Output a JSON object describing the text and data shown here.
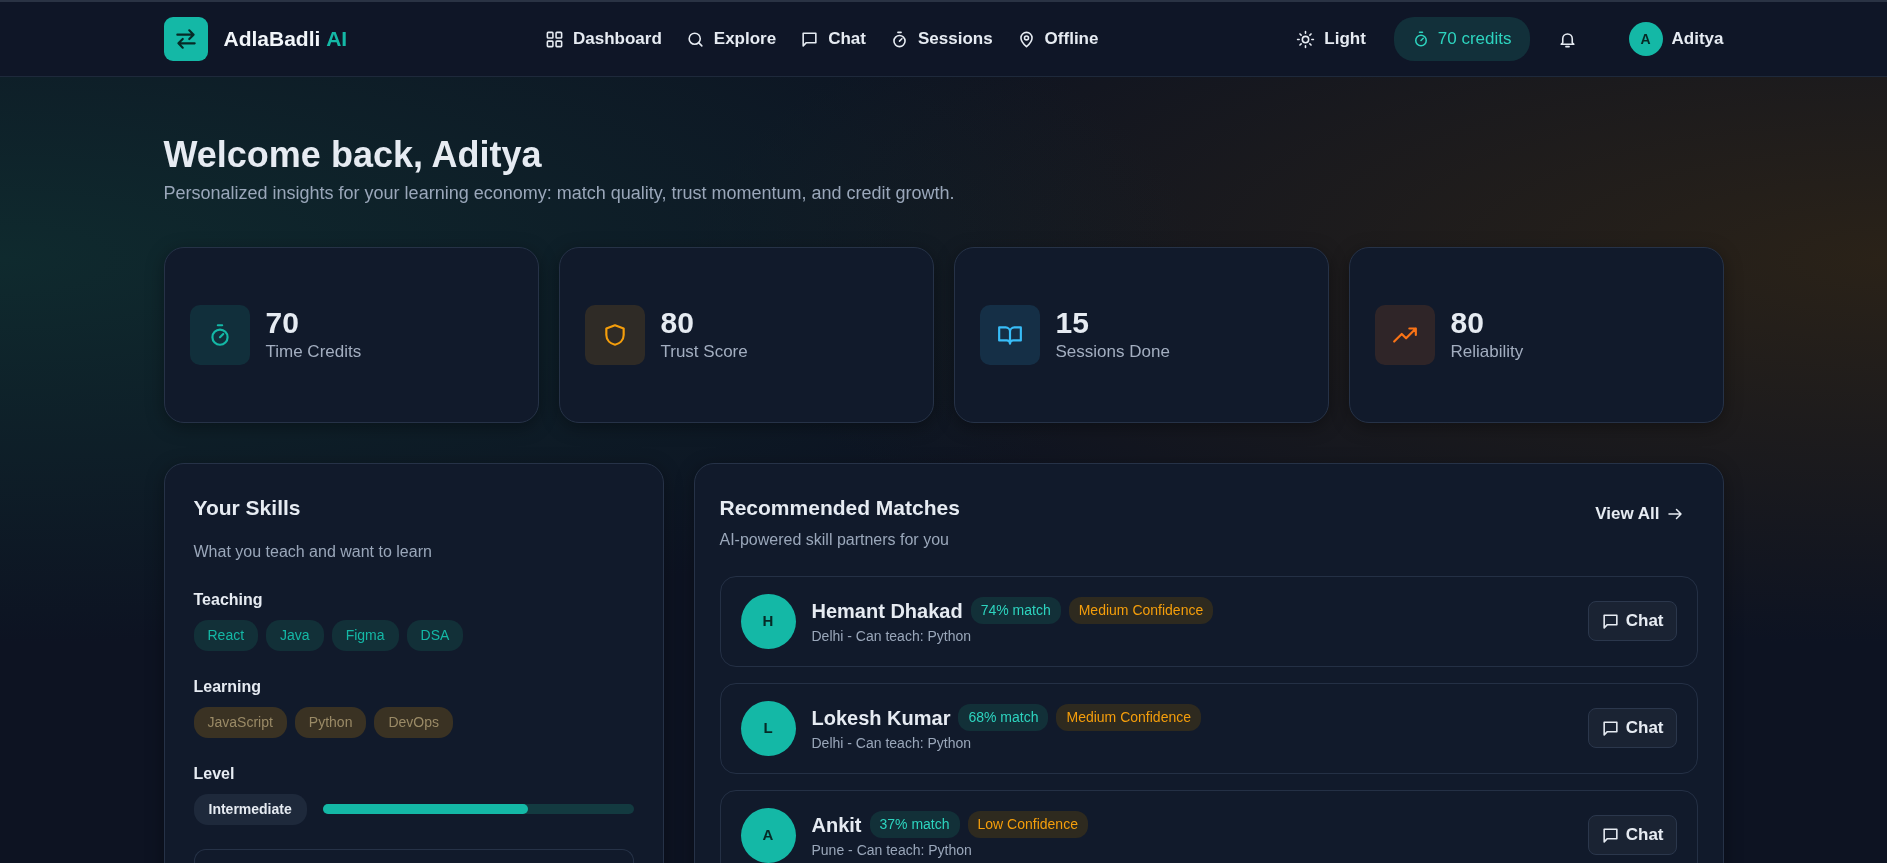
{
  "brand": {
    "name": "AdlaBadli",
    "suffix": "AI"
  },
  "nav": [
    {
      "label": "Dashboard"
    },
    {
      "label": "Explore"
    },
    {
      "label": "Chat"
    },
    {
      "label": "Sessions"
    },
    {
      "label": "Offline"
    }
  ],
  "theme_toggle": "Light",
  "credits": "70 credits",
  "user": {
    "initial": "A",
    "name": "Aditya"
  },
  "welcome": {
    "title": "Welcome back, Aditya",
    "subtitle": "Personalized insights for your learning economy: match quality, trust momentum, and credit growth."
  },
  "stats": [
    {
      "value": "70",
      "label": "Time Credits",
      "color": "#14b8a6"
    },
    {
      "value": "80",
      "label": "Trust Score",
      "color": "#f59e0b"
    },
    {
      "value": "15",
      "label": "Sessions Done",
      "color": "#38bdf8"
    },
    {
      "value": "80",
      "label": "Reliability",
      "color": "#f97316"
    }
  ],
  "skills": {
    "title": "Your Skills",
    "subtitle": "What you teach and want to learn",
    "groups": [
      {
        "label": "Teaching",
        "kind": "teach",
        "tags": [
          "React",
          "Java",
          "Figma",
          "DSA"
        ]
      },
      {
        "label": "Learning",
        "kind": "learn",
        "tags": [
          "JavaScript",
          "Python",
          "DevOps"
        ]
      }
    ],
    "level_label": "Level",
    "level_name": "Intermediate",
    "level": 0.66
  },
  "matches": {
    "title": "Recommended Matches",
    "subtitle": "AI-powered skill partners for you",
    "view_all": "View All",
    "items": [
      {
        "initial": "H",
        "name": "Hemant Dhakad",
        "match": "74% match",
        "confidence": "Medium Confidence",
        "detail": "Delhi - Can teach: Python",
        "action": "Chat"
      },
      {
        "initial": "L",
        "name": "Lokesh Kumar",
        "match": "68% match",
        "confidence": "Medium Confidence",
        "detail": "Delhi - Can teach: Python",
        "action": "Chat"
      },
      {
        "initial": "A",
        "name": "Ankit",
        "match": "37% match",
        "confidence": "Low Confidence",
        "detail": "Pune - Can teach: Python",
        "action": "Chat"
      }
    ]
  }
}
